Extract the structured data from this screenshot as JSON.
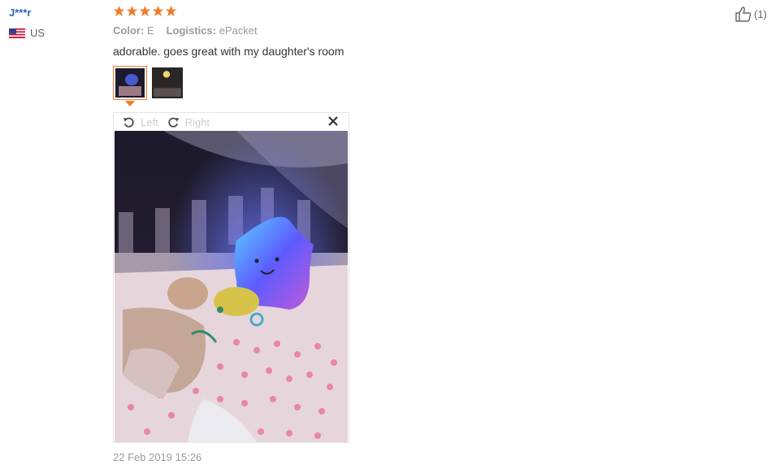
{
  "reviewer": {
    "name": "J***r",
    "country": "US",
    "flag_icon": "us-flag-icon"
  },
  "rating": {
    "stars": 5,
    "max": 5,
    "color": "#f07c2b"
  },
  "attributes": {
    "color_label": "Color:",
    "color_value": "E",
    "logistics_label": "Logistics:",
    "logistics_value": "ePacket"
  },
  "review": {
    "text": "adorable. goes great with my daughter's room",
    "date": "22 Feb 2019 15:26"
  },
  "helpful": {
    "count": "(1)",
    "icon": "thumbs-up-icon"
  },
  "viewer": {
    "rotate_left_label": "Left",
    "rotate_right_label": "Right",
    "close_icon": "close-icon"
  },
  "colors": {
    "accent": "#f07c2b",
    "link": "#2b63b9"
  }
}
